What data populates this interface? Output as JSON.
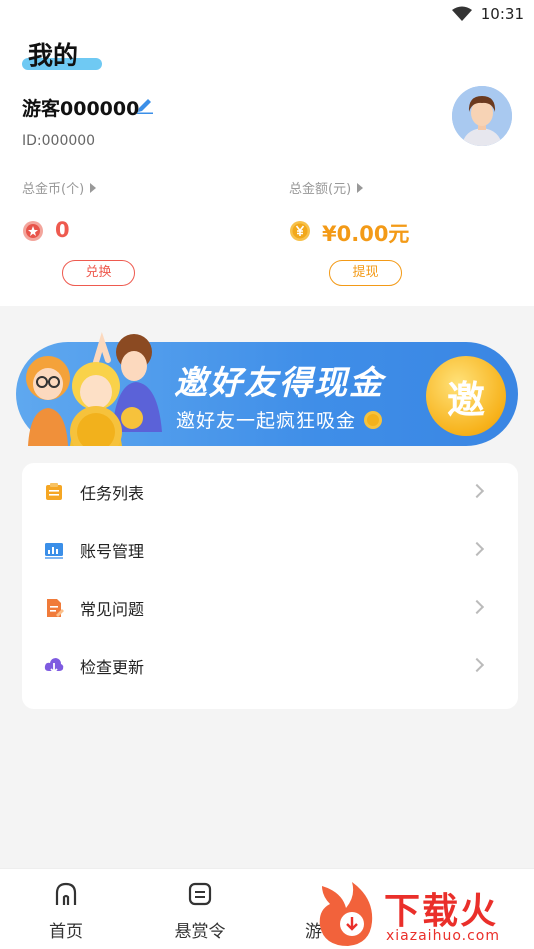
{
  "status_bar": {
    "time": "10:31"
  },
  "page": {
    "title": "我的"
  },
  "user": {
    "name": "游客000000",
    "id": "ID:000000"
  },
  "stats": {
    "coins": {
      "label": "总金币(个)",
      "value": "0",
      "button": "兑换",
      "accent": "#ee5a4f"
    },
    "balance": {
      "label": "总金额(元)",
      "value": "¥0.00元",
      "button": "提现",
      "accent": "#f39a17"
    }
  },
  "banner": {
    "title": "邀好友得现金",
    "subtitle": "邀好友一起疯狂吸金",
    "badge": "邀"
  },
  "menu": [
    {
      "label": "任务列表",
      "icon": "task-list-icon"
    },
    {
      "label": "账号管理",
      "icon": "account-icon"
    },
    {
      "label": "常见问题",
      "icon": "faq-icon"
    },
    {
      "label": "检查更新",
      "icon": "update-icon"
    }
  ],
  "bottom_nav": [
    {
      "label": "首页",
      "icon": "home-icon"
    },
    {
      "label": "悬赏令",
      "icon": "bounty-icon"
    },
    {
      "label": "游",
      "icon": ""
    }
  ],
  "watermark": {
    "brand": "下载火",
    "url": "xiazaihuo.com"
  }
}
